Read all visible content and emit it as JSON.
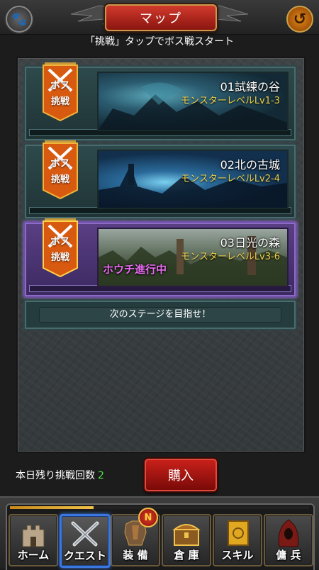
{
  "header": {
    "title": "マップ",
    "back_icon": "↺",
    "paw_icon": "🐾"
  },
  "hint": "「挑戦」タップでボス戦スタート",
  "stages": [
    {
      "name": "01試練の谷",
      "level": "モンスターレベルLv1-3",
      "status": "",
      "badge_line1": "ボス",
      "badge_line2": "挑戦"
    },
    {
      "name": "02北の古城",
      "level": "モンスターレベルLv2-4",
      "status": "",
      "badge_line1": "ボス",
      "badge_line2": "挑戦"
    },
    {
      "name": "03日光の森",
      "level": "モンスターレベルLv3-6",
      "status": "ホウチ進行中",
      "badge_line1": "ボス",
      "badge_line2": "挑戦"
    }
  ],
  "next_stage": "次のステージを目指せ！",
  "remaining": {
    "label": "本日残り挑戦回数",
    "count": "2"
  },
  "buy_label": "購入",
  "nav": {
    "progress": 0.28,
    "badge": "N",
    "items": [
      {
        "label": "ホーム"
      },
      {
        "label": "クエスト"
      },
      {
        "label": "装 備"
      },
      {
        "label": "倉 庫"
      },
      {
        "label": "スキル"
      },
      {
        "label": "傭 兵"
      }
    ]
  },
  "colors": {
    "accent_red": "#c8201a",
    "selected_blue": "#3a78e0",
    "level_yellow": "#f0d24a",
    "status_pink": "#e86cf0",
    "count_green": "#52e04a"
  }
}
